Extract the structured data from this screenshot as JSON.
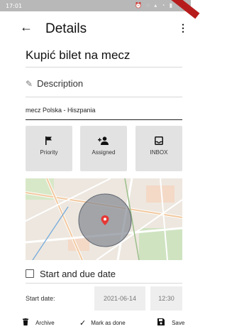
{
  "status_bar": {
    "time": "17:01",
    "indicators": [
      "alarm-icon",
      "mute-icon",
      "signal-icon",
      "wifi-icon",
      "battery-icon"
    ]
  },
  "app_bar": {
    "title": "Details",
    "back_icon": "arrow-left-icon",
    "menu_icon": "more-vert-icon"
  },
  "task": {
    "title": "Kupić bilet na mecz"
  },
  "description": {
    "heading": "Description",
    "icon": "pencil-icon",
    "value": "mecz Polska - Hiszpania"
  },
  "tiles": [
    {
      "label": "Priority",
      "icon": "flag-icon"
    },
    {
      "label": "Assigned",
      "icon": "person-add-icon"
    },
    {
      "label": "INBOX",
      "icon": "inbox-icon"
    }
  ],
  "map": {
    "marker_color": "#e53935",
    "radius_color": "#7a7f8a"
  },
  "schedule": {
    "heading": "Start and due date",
    "start_label": "Start date:",
    "start_date": "2021-06-14",
    "start_time": "12:30"
  },
  "bottom_bar": {
    "archive": "Archive",
    "mark_done": "Mark as done",
    "save": "Save"
  },
  "colors": {
    "tile_bg": "#e2e2e2",
    "field_bg": "#eeeeee",
    "accent_ribbon": "#b71c1c"
  }
}
